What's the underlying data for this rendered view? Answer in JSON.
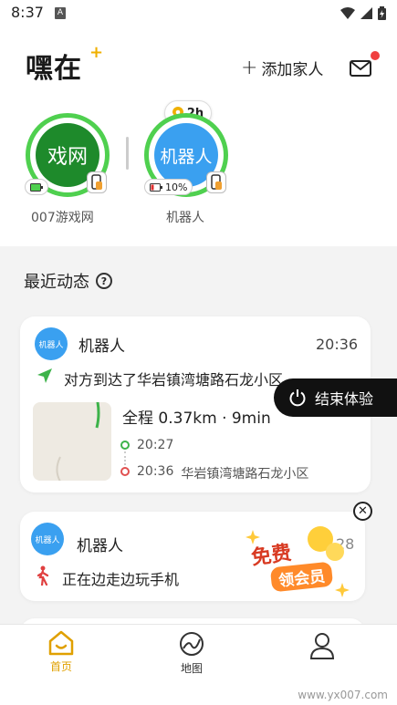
{
  "status_bar": {
    "time": "8:37",
    "notif_letter": "A"
  },
  "header": {
    "app_title": "嘿在",
    "logo_plus": "+",
    "add_family_label": "添加家人"
  },
  "members": [
    {
      "avatar_text": "戏网",
      "name": "007游戏网",
      "battery": ""
    },
    {
      "avatar_text": "机器人",
      "name": "机器人",
      "battery": "10%",
      "last_seen": "2h"
    }
  ],
  "recent": {
    "title": "最近动态",
    "help_glyph": "?"
  },
  "card1": {
    "avatar_text": "机器人",
    "name": "机器人",
    "time": "20:36",
    "event": "对方到达了华岩镇湾塘路石龙小区",
    "trip": "全程 0.37km · 9min",
    "start_time": "20:27",
    "end_time": "20:36",
    "end_place": "华岩镇湾塘路石龙小区"
  },
  "end_trial": {
    "label": "结束体验"
  },
  "card2": {
    "avatar_text": "机器人",
    "name": "机器人",
    "event": "正在边走边玩手机",
    "time_partial": "28"
  },
  "promo": {
    "line1": "免费",
    "line2": "领会员",
    "close_glyph": "✕"
  },
  "nav": {
    "home": "首页",
    "map": "地图"
  },
  "watermark": "www.yx007.com",
  "colors": {
    "green": "#4fd04f",
    "blue": "#3aa0f0",
    "accent": "#f0b000",
    "active_nav": "#e0a000",
    "alert": "#f04040"
  }
}
